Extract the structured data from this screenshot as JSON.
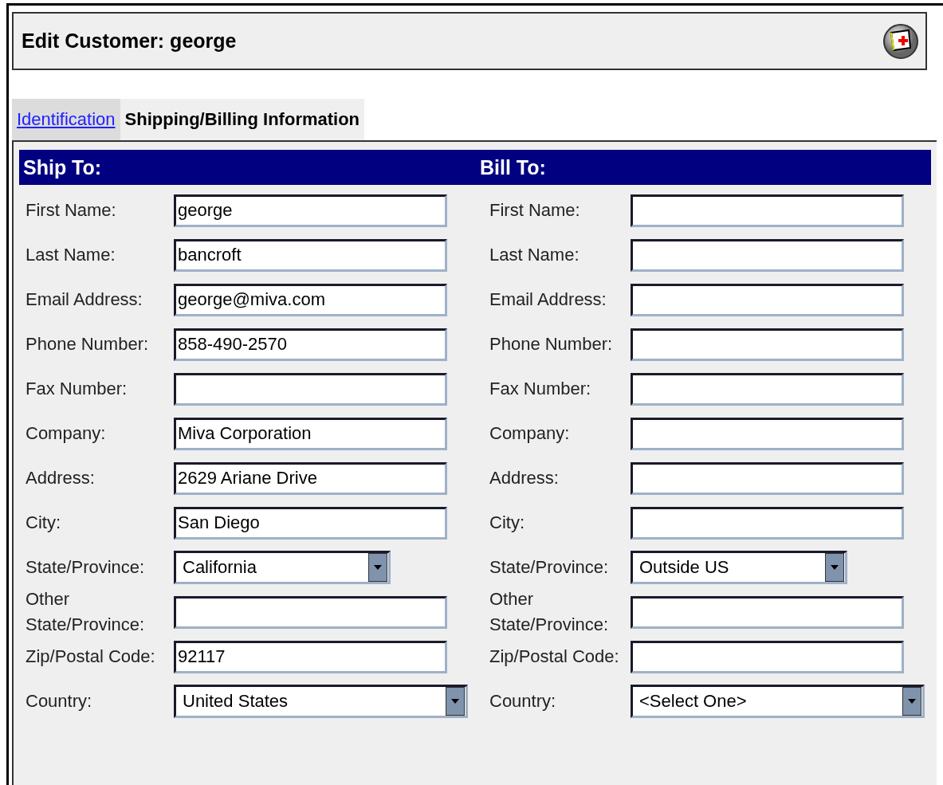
{
  "header": {
    "title": "Edit Customer: george"
  },
  "tabs": [
    {
      "label": "Identification",
      "selected": false
    },
    {
      "label": "Shipping/Billing Information",
      "selected": true
    }
  ],
  "columns": [
    {
      "heading": "Ship To:",
      "fields": [
        {
          "label": "First Name:",
          "kind": "text",
          "value": "george"
        },
        {
          "label": "Last Name:",
          "kind": "text",
          "value": "bancroft"
        },
        {
          "label": "Email Address:",
          "kind": "text",
          "value": "george@miva.com"
        },
        {
          "label": "Phone Number:",
          "kind": "text",
          "value": "858-490-2570"
        },
        {
          "label": "Fax Number:",
          "kind": "text"
        },
        {
          "label": "Company:",
          "kind": "text",
          "value": "Miva Corporation"
        },
        {
          "label": "Address:",
          "kind": "text",
          "value": "2629 Ariane Drive"
        },
        {
          "label": "City:",
          "kind": "text",
          "value": "San Diego"
        },
        {
          "label": "State/Province:",
          "kind": "select",
          "value": "California"
        },
        {
          "label": "Other State/Province:",
          "kind": "text"
        },
        {
          "label": "Zip/Postal Code:",
          "kind": "text",
          "value": "92117"
        },
        {
          "label": "Country:",
          "kind": "select",
          "value": "United States"
        }
      ]
    },
    {
      "heading": "Bill To:",
      "fields": [
        {
          "label": "First Name:",
          "kind": "text"
        },
        {
          "label": "Last Name:",
          "kind": "text"
        },
        {
          "label": "Email Address:",
          "kind": "text"
        },
        {
          "label": "Phone Number:",
          "kind": "text"
        },
        {
          "label": "Fax Number:",
          "kind": "text"
        },
        {
          "label": "Company:",
          "kind": "text"
        },
        {
          "label": "Address:",
          "kind": "text"
        },
        {
          "label": "City:",
          "kind": "text"
        },
        {
          "label": "State/Province:",
          "kind": "select",
          "value": "Outside US"
        },
        {
          "label": "Other State/Province:",
          "kind": "text"
        },
        {
          "label": "Zip/Postal Code:",
          "kind": "text"
        },
        {
          "label": "Country:",
          "kind": "select",
          "value": "<Select One>"
        }
      ]
    }
  ]
}
